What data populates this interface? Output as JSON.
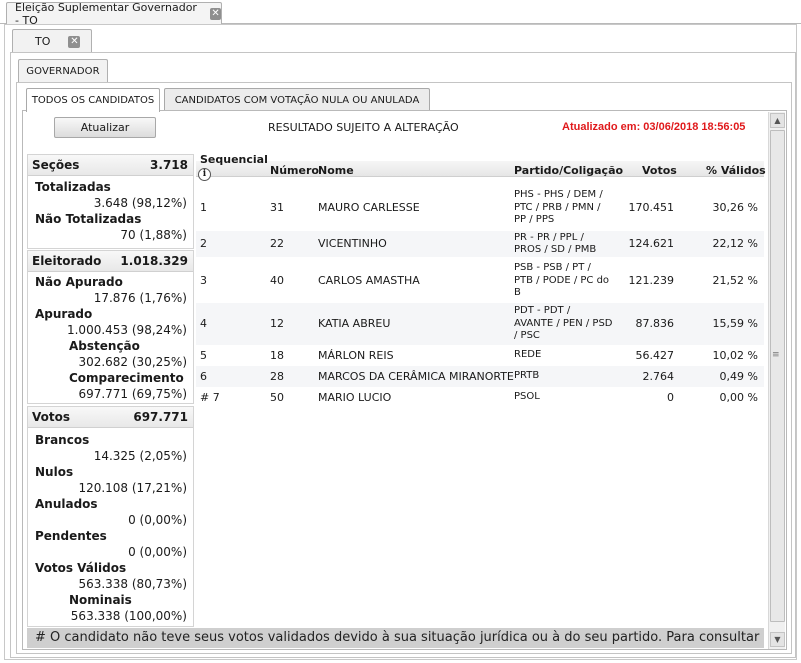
{
  "window": {
    "title": "Eleição Suplementar Governador - TO"
  },
  "state_tab": {
    "label": "TO"
  },
  "office_tab": {
    "label": "GOVERNADOR"
  },
  "subtabs": {
    "all": "TODOS OS CANDIDATOS",
    "null_votes": "CANDIDATOS COM VOTAÇÃO NULA OU ANULADA"
  },
  "toolbar": {
    "refresh_label": "Atualizar",
    "notice": "RESULTADO SUJEITO A ALTERAÇÃO",
    "updated": "Atualizado em: 03/06/2018 18:56:05"
  },
  "stats": {
    "secoes": {
      "label": "Seções",
      "value": "3.718",
      "totalizadas_label": "Totalizadas",
      "totalizadas_value": "3.648 (98,12%)",
      "nao_totalizadas_label": "Não Totalizadas",
      "nao_totalizadas_value": "70 (1,88%)"
    },
    "eleitorado": {
      "label": "Eleitorado",
      "value": "1.018.329",
      "nao_apurado_label": "Não Apurado",
      "nao_apurado_value": "17.876 (1,76%)",
      "apurado_label": "Apurado",
      "apurado_value": "1.000.453 (98,24%)",
      "abstencao_label": "Abstenção",
      "abstencao_value": "302.682 (30,25%)",
      "comparecimento_label": "Comparecimento",
      "comparecimento_value": "697.771 (69,75%)"
    },
    "votos": {
      "label": "Votos",
      "value": "697.771",
      "brancos_label": "Brancos",
      "brancos_value": "14.325 (2,05%)",
      "nulos_label": "Nulos",
      "nulos_value": "120.108 (17,21%)",
      "anulados_label": "Anulados",
      "anulados_value": "0 (0,00%)",
      "pendentes_label": "Pendentes",
      "pendentes_value": "0 (0,00%)",
      "validos_label": "Votos Válidos",
      "validos_value": "563.338 (80,73%)",
      "nominais_label": "Nominais",
      "nominais_value": "563.338 (100,00%)"
    }
  },
  "table": {
    "headers": {
      "seq": "Sequencial",
      "num": "Número",
      "name": "Nome",
      "party": "Partido/Coligação",
      "votes": "Votos",
      "valid": "% Válidos"
    },
    "rows": [
      {
        "seq": "1",
        "num": "31",
        "name": "MAURO CARLESSE",
        "party": [
          "PHS - PHS / DEM /",
          "PTC / PRB / PMN /",
          "PP / PPS"
        ],
        "votes": "170.451",
        "valid": "30,26 %"
      },
      {
        "seq": "2",
        "num": "22",
        "name": "VICENTINHO",
        "party": [
          "PR - PR / PPL /",
          "PROS / SD / PMB"
        ],
        "votes": "124.621",
        "valid": "22,12 %"
      },
      {
        "seq": "3",
        "num": "40",
        "name": "CARLOS AMASTHA",
        "party": [
          "PSB - PSB / PT /",
          "PTB / PODE / PC do",
          "B"
        ],
        "votes": "121.239",
        "valid": "21,52 %"
      },
      {
        "seq": "4",
        "num": "12",
        "name": "KATIA ABREU",
        "party": [
          "PDT - PDT /",
          "AVANTE / PEN / PSD",
          "/ PSC"
        ],
        "votes": "87.836",
        "valid": "15,59 %"
      },
      {
        "seq": "5",
        "num": "18",
        "name": "MÁRLON REIS",
        "party": [
          "REDE"
        ],
        "votes": "56.427",
        "valid": "10,02 %"
      },
      {
        "seq": "6",
        "num": "28",
        "name": "MARCOS DA CERÂMICA MIRANORTE",
        "party": [
          "PRTB"
        ],
        "votes": "2.764",
        "valid": "0,49 %"
      },
      {
        "seq": "# 7",
        "num": "50",
        "name": "MARIO LUCIO",
        "party": [
          "PSOL"
        ],
        "votes": "0",
        "valid": "0,00 %"
      }
    ]
  },
  "footnote": "# O candidato não teve seus votos validados devido à sua situação jurídica ou à do seu partido. Para consultar a"
}
